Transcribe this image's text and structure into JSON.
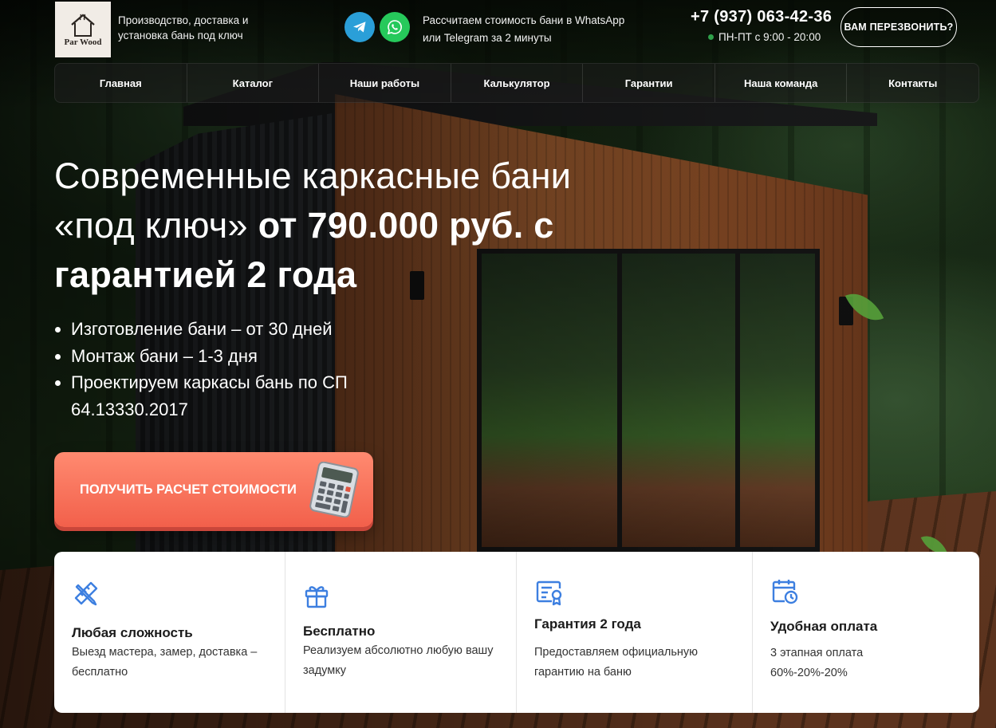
{
  "header": {
    "logo_text": "Par Wood",
    "tagline": "Производство, доставка и установка бань под ключ",
    "telegram_icon": "telegram-icon",
    "whatsapp_icon": "whatsapp-icon",
    "calc_note": "Рассчитаем стоимость бани в WhatsApp или Telegram за 2 минуты",
    "phone": "+7 (937) 063-42-36",
    "hours": "ПН-ПТ с 9:00 - 20:00",
    "callback_label": "ВАМ ПЕРЕЗВОНИТЬ?"
  },
  "nav": [
    {
      "label": "Главная"
    },
    {
      "label": "Каталог"
    },
    {
      "label": "Наши работы"
    },
    {
      "label": "Калькулятор"
    },
    {
      "label": "Гарантии"
    },
    {
      "label": "Наша команда"
    },
    {
      "label": "Контакты"
    }
  ],
  "hero": {
    "title_light": "Современные каркасные бани «под ключ»",
    "title_bold": "от 790.000 руб. с гарантией 2 года",
    "bullets": [
      "Изготовление бани – от 30 дней",
      "Монтаж бани – 1-3 дня",
      "Проектируем каркасы бань по СП 64.13330.2017"
    ],
    "cta_label": "ПОЛУЧИТЬ РАСЧЕТ СТОИМОСТИ",
    "cta_icon": "calculator-icon"
  },
  "features": [
    {
      "icon": "pencil-ruler-icon",
      "title": "Любая сложность",
      "text": "Выезд мастера, замер, доставка – бесплатно"
    },
    {
      "icon": "gift-icon",
      "title": "Бесплатно",
      "text": "Реализуем абсолютно любую вашу задумку"
    },
    {
      "icon": "certificate-icon",
      "title": "Гарантия 2 года",
      "text": "Предоставляем официальную гарантию на баню"
    },
    {
      "icon": "calendar-clock-icon",
      "title": "Удобная оплата",
      "text": "3 этапная оплата 60%-20%-20%"
    }
  ],
  "colors": {
    "accent": "#f2604b",
    "telegram": "#2a9fd8",
    "whatsapp": "#26c95b",
    "feature_icon": "#3d7fe0"
  }
}
